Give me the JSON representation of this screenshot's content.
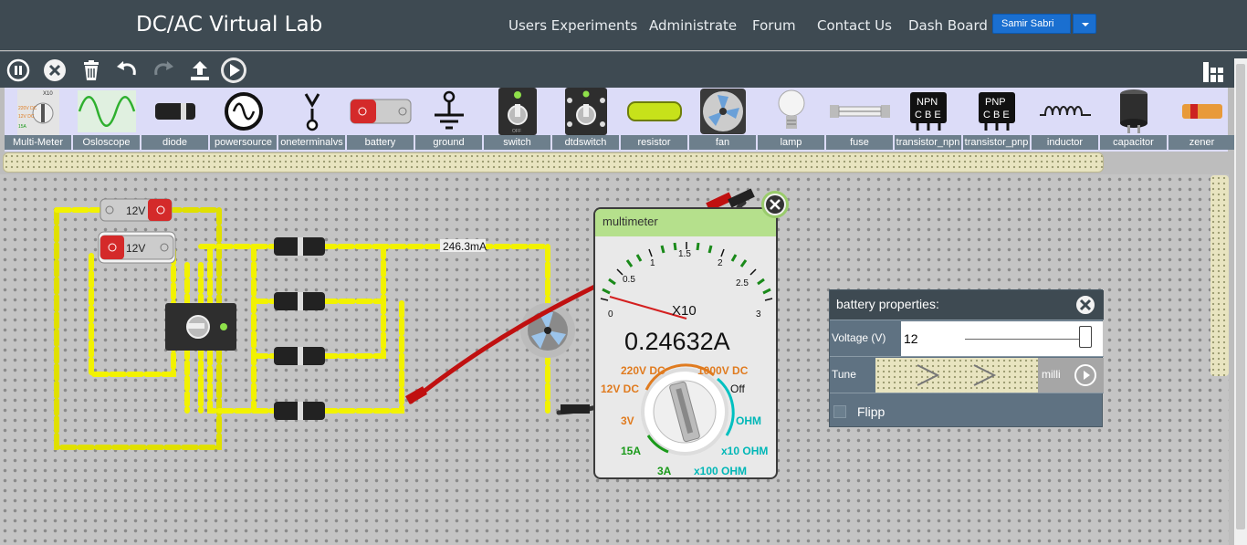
{
  "header": {
    "brand": "DC/AC Virtual Lab",
    "nav": [
      "Users Experiments",
      "Administrate",
      "Forum",
      "Contact Us",
      "Dash Board"
    ],
    "user": "Samir Sabri"
  },
  "toolbar": {
    "buttons": [
      "pause-icon",
      "close-icon",
      "trash-icon",
      "undo-icon",
      "redo-icon",
      "upload-icon",
      "play-icon"
    ],
    "right_button": "layout-icon"
  },
  "palette": {
    "items": [
      "Multi-Meter",
      "Osloscope",
      "diode",
      "powersource",
      "oneterminalvs",
      "battery",
      "ground",
      "switch",
      "dtdswitch",
      "resistor",
      "fan",
      "lamp",
      "fuse",
      "transistor_npn",
      "transistor_pnp",
      "inductor",
      "capacitor",
      "zener"
    ],
    "multimeter_icon_text": "X10",
    "npn_text": [
      "NPN",
      "C B E"
    ],
    "pnp_text": [
      "PNP",
      "C B E"
    ]
  },
  "circuit": {
    "battery1_label": "12V",
    "battery2_label": "12V",
    "current_label": "246.3mA"
  },
  "multimeter": {
    "title": "multimeter",
    "reading": "0.24632A",
    "multiplier": "X10",
    "scale": [
      "0",
      "0.5",
      "1",
      "1.5",
      "2",
      "2.5",
      "3"
    ],
    "modes": {
      "v220": "220V DC",
      "v1000": "1000V DC",
      "v12": "12V DC",
      "off": "Off",
      "v3": "3V",
      "ohm": "OHM",
      "a15": "15A",
      "ohm10": "x10 OHM",
      "a3": "3A",
      "ohm100": "x100 OHM"
    },
    "colors": {
      "ohm": "#00b7b7",
      "dc": "#e07b1f",
      "amp": "#1a9a1a"
    }
  },
  "battery_properties": {
    "title": "battery properties:",
    "voltage_label": "Voltage (V)",
    "voltage_value": "12",
    "voltage_slider_fraction": 1.0,
    "tune_label": "Tune",
    "unit_label": "milli",
    "flip_label": "Flipp"
  }
}
